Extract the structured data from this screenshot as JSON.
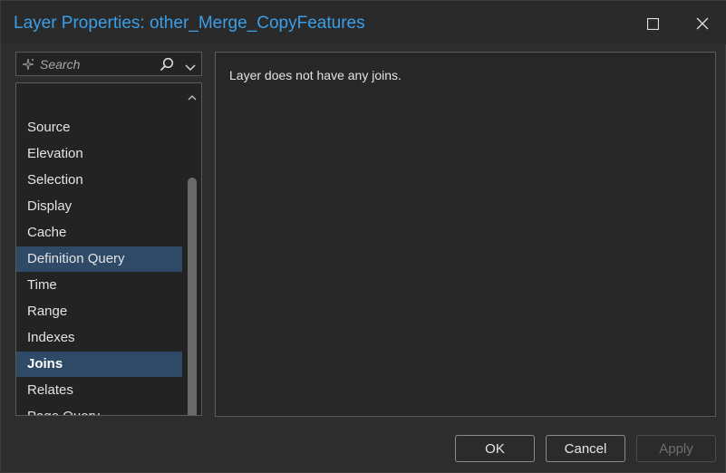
{
  "window": {
    "title": "Layer Properties: other_Merge_CopyFeatures",
    "maximize_icon": "maximize-icon",
    "close_icon": "close-icon"
  },
  "search": {
    "placeholder": "Search",
    "value": ""
  },
  "nav": {
    "items": [
      {
        "label": "Source",
        "state": "normal"
      },
      {
        "label": "Elevation",
        "state": "normal"
      },
      {
        "label": "Selection",
        "state": "normal"
      },
      {
        "label": "Display",
        "state": "normal"
      },
      {
        "label": "Cache",
        "state": "normal"
      },
      {
        "label": "Definition Query",
        "state": "highlighted"
      },
      {
        "label": "Time",
        "state": "normal"
      },
      {
        "label": "Range",
        "state": "normal"
      },
      {
        "label": "Indexes",
        "state": "normal"
      },
      {
        "label": "Joins",
        "state": "selected"
      },
      {
        "label": "Relates",
        "state": "normal"
      },
      {
        "label": "Page Query",
        "state": "normal"
      }
    ]
  },
  "content": {
    "message": "Layer does not have any joins."
  },
  "buttons": {
    "ok": "OK",
    "cancel": "Cancel",
    "apply": "Apply"
  },
  "colors": {
    "title_accent": "#3a9ee8",
    "selection": "#2f4a67",
    "background": "#2d2d2d"
  }
}
